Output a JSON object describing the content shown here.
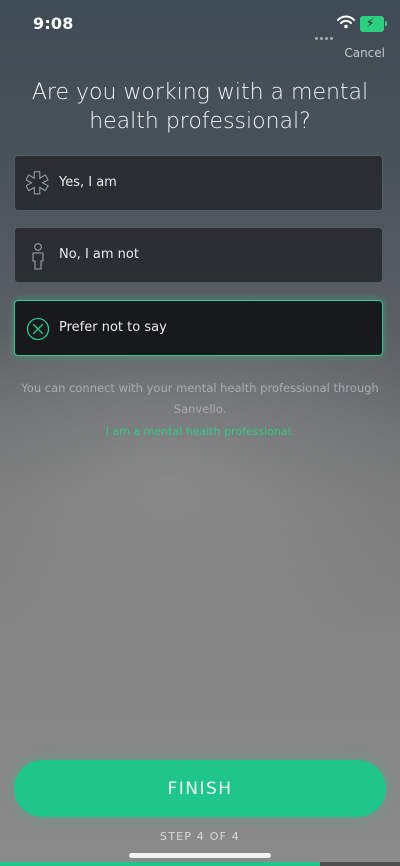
{
  "status_bar": {
    "time": "9:08"
  },
  "header": {
    "cancel_label": "Cancel"
  },
  "title": "Are you working with a mental health professional?",
  "options": [
    {
      "label": "Yes, I am",
      "icon": "medical-star-icon",
      "selected": false
    },
    {
      "label": "No, I am not",
      "icon": "person-icon",
      "selected": false
    },
    {
      "label": "Prefer not to say",
      "icon": "circle-x-icon",
      "selected": true
    }
  ],
  "info_text": "You can connect with your mental health professional through Sanvello.",
  "professional_link": "I am a mental health professional.",
  "finish_label": "FINISH",
  "step_label": "STEP 4 OF 4",
  "progress": 0.8,
  "colors": {
    "accent": "#1fc58a",
    "selected_border": "#2ecb8a"
  }
}
